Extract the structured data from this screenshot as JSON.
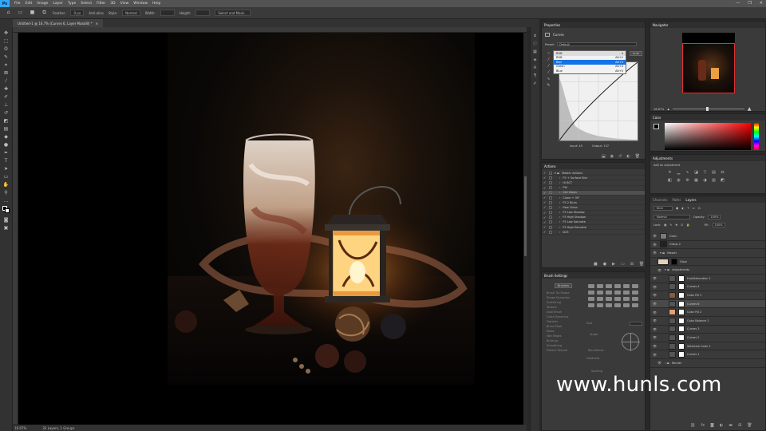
{
  "menu": {
    "logo": "Ps",
    "items": [
      "File",
      "Edit",
      "Image",
      "Layer",
      "Type",
      "Select",
      "Filter",
      "3D",
      "View",
      "Window",
      "Help"
    ],
    "window_controls": [
      "—",
      "❐",
      "✕"
    ]
  },
  "options": {
    "feather_label": "Feather:",
    "feather_value": "0 px",
    "antialias_label": "Anti-alias",
    "style_label": "Style:",
    "style_value": "Normal",
    "width_label": "Width:",
    "height_label": "Height:",
    "select_mask_label": "Select and Mask..."
  },
  "document": {
    "tab_title": "Untitled-1 @ 16.7% (Curves 6, Layer Mask/8) *",
    "close": "×",
    "zoom": "16.67%",
    "status_info": "32 Layers, 1 Groups"
  },
  "properties": {
    "header": "Properties",
    "panel_title": "Curves",
    "preset_label": "Preset:",
    "preset_value": "Default",
    "channel_value": "RGB",
    "auto_label": "Auto",
    "channels": [
      {
        "name": "RGB",
        "shortcut": "Alt+2"
      },
      {
        "name": "Red",
        "shortcut": "Alt+3"
      },
      {
        "name": "Green",
        "shortcut": "Alt+4"
      },
      {
        "name": "Blue",
        "shortcut": "Alt+5"
      }
    ],
    "input_label": "Input:",
    "input_value": "45",
    "output_label": "Output:",
    "output_value": "137"
  },
  "actions": {
    "header": "Actions",
    "rows": [
      {
        "label": "Master Actions",
        "indent": 0,
        "folder": true
      },
      {
        "label": "F5 + Surface Blur",
        "indent": 1
      },
      {
        "label": "Hi BCT",
        "indent": 1
      },
      {
        "label": "FW",
        "indent": 1
      },
      {
        "label": "Ctrl Clean",
        "indent": 1,
        "highlight": true
      },
      {
        "label": "Clone + Off",
        "indent": 1
      },
      {
        "label": "F5 2 Blurs",
        "indent": 1
      },
      {
        "label": "Raw Clean",
        "indent": 1
      },
      {
        "label": "F5 Low Shadow",
        "indent": 1
      },
      {
        "label": "F5 High Shadow",
        "indent": 1
      },
      {
        "label": "F5 Low Saturate",
        "indent": 1
      },
      {
        "label": "F5 High Saturate",
        "indent": 1
      },
      {
        "label": "D25",
        "indent": 1
      }
    ]
  },
  "brush_settings": {
    "header": "Brush Settings",
    "brushes_button": "Brushes",
    "options": [
      "Brush Tip Shape",
      "Shape Dynamics",
      "Scattering",
      "Texture",
      "Dual Brush",
      "Color Dynamics",
      "Transfer",
      "Brush Pose",
      "Noise",
      "Wet Edges",
      "Build-up",
      "Smoothing",
      "Protect Texture"
    ],
    "size_label": "Size",
    "angle_label": "Angle:",
    "roundness_label": "Roundness:",
    "hardness_label": "Hardness",
    "spacing_label": "Spacing"
  },
  "navigator": {
    "header": "Navigator",
    "zoom": "16.67%"
  },
  "color_panel": {
    "header": "Color"
  },
  "adjustments": {
    "header": "Adjustments",
    "subtitle": "Add an adjustment"
  },
  "layers": {
    "tabs": [
      "Channels",
      "Paths",
      "Layers"
    ],
    "kind_label": "Kind",
    "blend_mode": "Normal",
    "opacity_label": "Opacity:",
    "opacity_value": "100%",
    "lock_label": "Lock:",
    "fill_label": "Fill:",
    "fill_value": "100%",
    "rows": [
      {
        "name": "Grain",
        "thumb": "#7a7a7a",
        "mask": false,
        "indent": 0
      },
      {
        "name": "Group 2",
        "thumb": "#222",
        "mask": false,
        "indent": 0
      },
      {
        "name": "Master",
        "folder": true,
        "indent": 0
      },
      {
        "name": "Glow",
        "thumb": "#e6d2b8",
        "mask": true,
        "maskdark": true,
        "indent": 1
      },
      {
        "name": "Adjustments",
        "folder": true,
        "indent": 1
      },
      {
        "name": "Hue/Saturation 1",
        "thumb": "#555",
        "mask": true,
        "indent": 2
      },
      {
        "name": "Curves 4",
        "thumb": "#555",
        "mask": true,
        "indent": 2
      },
      {
        "name": "Color Fill 1",
        "thumb": "#8a5a3a",
        "mask": true,
        "indent": 2
      },
      {
        "name": "Curves 6",
        "thumb": "#555",
        "mask": true,
        "indent": 2,
        "highlight": true
      },
      {
        "name": "Color Fill 2",
        "thumb": "#e8a070",
        "mask": true,
        "indent": 2
      },
      {
        "name": "Color Balance 1",
        "thumb": "#555",
        "mask": true,
        "indent": 2
      },
      {
        "name": "Curves 3",
        "thumb": "#555",
        "mask": true,
        "indent": 2
      },
      {
        "name": "Curves 2",
        "thumb": "#555",
        "mask": true,
        "indent": 2
      },
      {
        "name": "Selective Color 1",
        "thumb": "#555",
        "mask": true,
        "indent": 2
      },
      {
        "name": "Curves 1",
        "thumb": "#555",
        "mask": true,
        "indent": 2
      },
      {
        "name": "Render",
        "folder": true,
        "indent": 1
      }
    ]
  },
  "watermark": "www.hunls.com",
  "colors": {
    "accent": "#31a8ff",
    "selection": "#1473e6",
    "panel": "#3a3a3a"
  }
}
